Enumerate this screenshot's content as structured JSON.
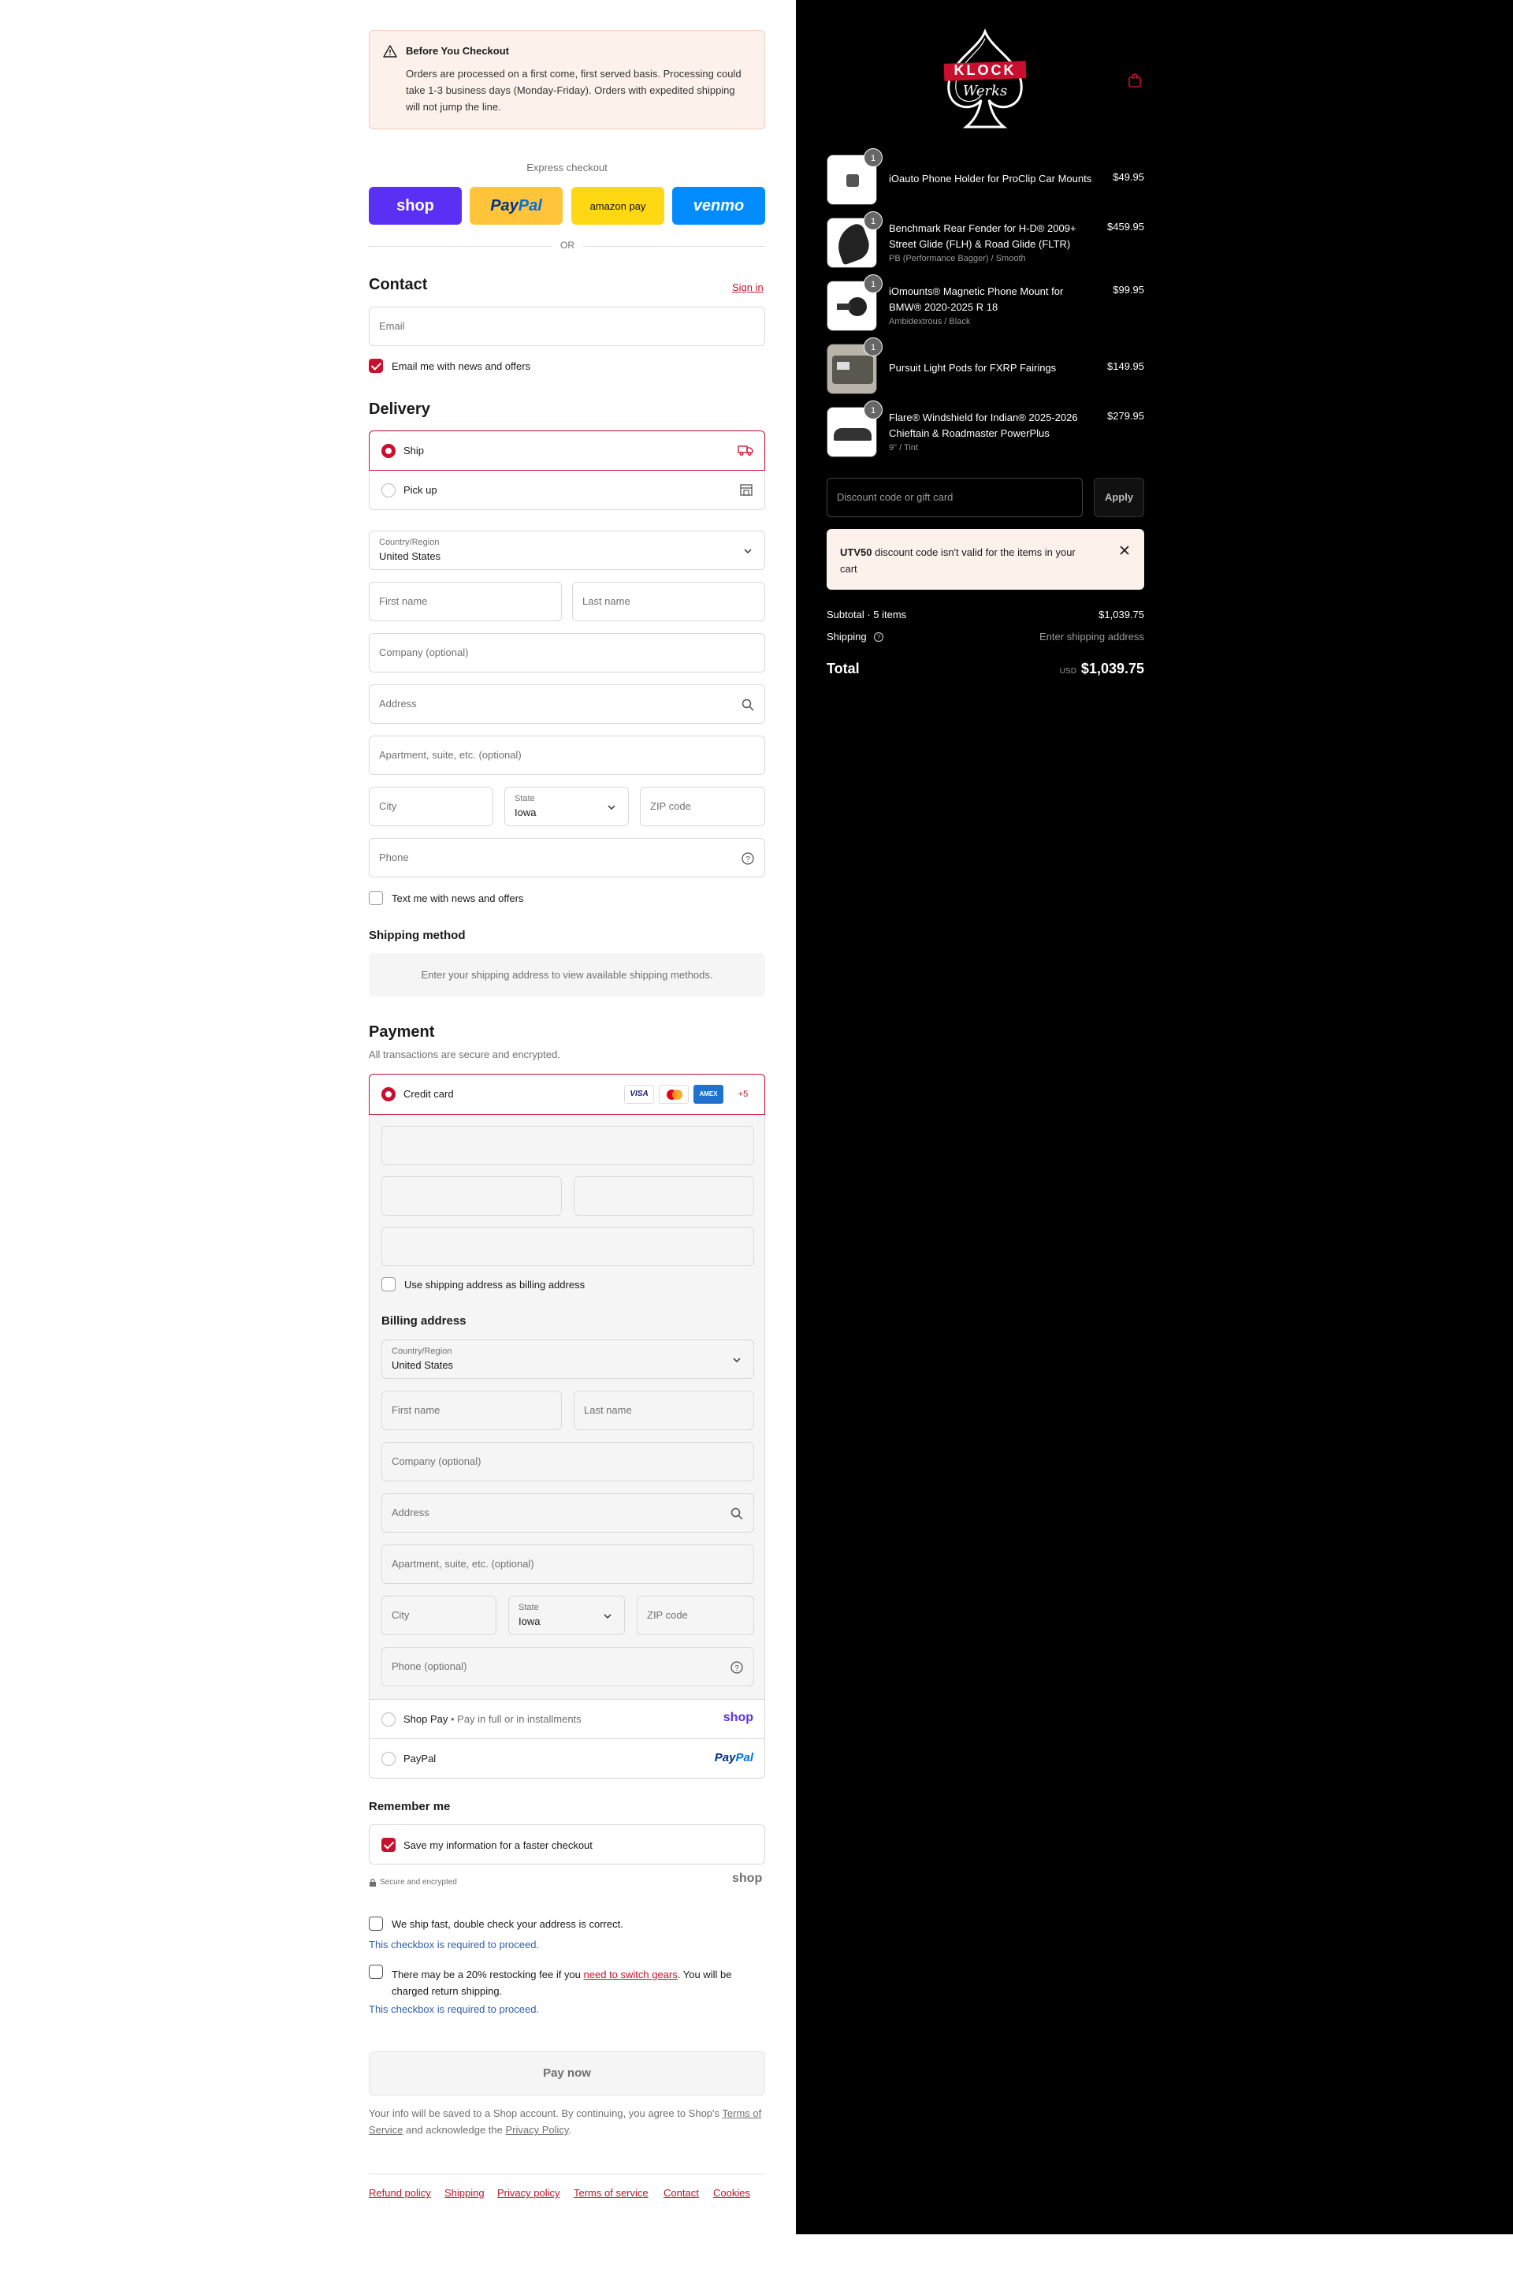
{
  "notice": {
    "title": "Before You Checkout",
    "body": "Orders are processed on a first come, first served basis. Processing could take 1-3 business days (Monday-Friday). Orders with expedited shipping will not jump the line."
  },
  "express": {
    "label": "Express checkout",
    "shop": "shop",
    "paypal_a": "Pay",
    "paypal_b": "Pal",
    "amazon": "amazon pay",
    "venmo": "venmo",
    "or": "OR"
  },
  "contact": {
    "heading": "Contact",
    "signin": "Sign in",
    "email_placeholder": "Email",
    "email_news": "Email me with news and offers"
  },
  "delivery": {
    "heading": "Delivery",
    "ship": "Ship",
    "pickup": "Pick up",
    "country_label": "Country/Region",
    "country": "United States",
    "first_name": "First name",
    "last_name": "Last name",
    "company": "Company (optional)",
    "address": "Address",
    "apartment": "Apartment, suite, etc. (optional)",
    "city": "City",
    "state_label": "State",
    "state": "Iowa",
    "zip": "ZIP code",
    "phone": "Phone",
    "text_news": "Text me with news and offers"
  },
  "shipping_method": {
    "heading": "Shipping method",
    "message": "Enter your shipping address to view available shipping methods."
  },
  "payment": {
    "heading": "Payment",
    "subtitle": "All transactions are secure and encrypted.",
    "credit_card": "Credit card",
    "visa": "VISA",
    "amex": "AMEX",
    "more_cards": "+5",
    "use_shipping": "Use shipping address as billing address",
    "billing_heading": "Billing address",
    "billing_country_label": "Country/Region",
    "billing_country": "United States",
    "billing_first": "First name",
    "billing_last": "Last name",
    "billing_company": "Company (optional)",
    "billing_address": "Address",
    "billing_apartment": "Apartment, suite, etc. (optional)",
    "billing_city": "City",
    "billing_state_label": "State",
    "billing_state": "Iowa",
    "billing_zip": "ZIP code",
    "billing_phone": "Phone (optional)",
    "shop_pay": "Shop Pay",
    "shop_pay_desc": "Pay in full or in installments",
    "shop_pay_logo": "shop",
    "paypal": "PayPal",
    "paypal_logo_a": "Pay",
    "paypal_logo_b": "Pal"
  },
  "remember": {
    "heading": "Remember me",
    "save_info": "Save my information for a faster checkout",
    "secure": "Secure and encrypted",
    "shop_logo": "shop"
  },
  "confirmations": {
    "ship_fast": "We ship fast, double check your address is correct.",
    "required_1": "This checkbox is required to proceed.",
    "restock_a": "There may be a 20% restocking fee if you",
    "restock_link": "need to switch gears",
    "restock_b": ". You will be charged return shipping.",
    "required_2": "This checkbox is required to proceed."
  },
  "pay_now": "Pay now",
  "legal": {
    "a": "Your info will be saved to a Shop account. By continuing, you agree to Shop's",
    "terms": "Terms of Service",
    "b": "and acknowledge the",
    "privacy": "Privacy Policy",
    "c": "."
  },
  "footer": {
    "refund": "Refund policy",
    "shipping": "Shipping",
    "privacy": "Privacy policy",
    "terms": "Terms of service",
    "contact": "Contact",
    "cookies": "Cookies"
  },
  "brand": {
    "logo_top": "KLOCK",
    "logo_bottom": "Werks",
    "accent": "#c8102e"
  },
  "cart": {
    "items": [
      {
        "name": "iOauto Phone Holder for ProClip Car Mounts",
        "variant": "",
        "price": "$49.95",
        "qty": "1"
      },
      {
        "name": "Benchmark Rear Fender for H-D® 2009+ Street Glide (FLH) & Road Glide (FLTR)",
        "variant": "PB (Performance Bagger) / Smooth",
        "price": "$459.95",
        "qty": "1"
      },
      {
        "name": "iOmounts® Magnetic Phone Mount for BMW® 2020-2025 R 18",
        "variant": "Ambidextrous / Black",
        "price": "$99.95",
        "qty": "1"
      },
      {
        "name": "Pursuit Light Pods for FXRP Fairings",
        "variant": "",
        "price": "$149.95",
        "qty": "1"
      },
      {
        "name": "Flare® Windshield for Indian® 2025-2026 Chieftain & Roadmaster PowerPlus",
        "variant": "9\" / Tint",
        "price": "$279.95",
        "qty": "1"
      }
    ],
    "discount_placeholder": "Discount code or gift card",
    "apply": "Apply",
    "error_code": "UTV50",
    "error_msg": "discount code isn't valid for the items in your cart",
    "subtotal_label": "Subtotal · 5 items",
    "subtotal": "$1,039.75",
    "shipping_label": "Shipping",
    "shipping_value": "Enter shipping address",
    "total_label": "Total",
    "currency": "USD",
    "total": "$1,039.75"
  }
}
